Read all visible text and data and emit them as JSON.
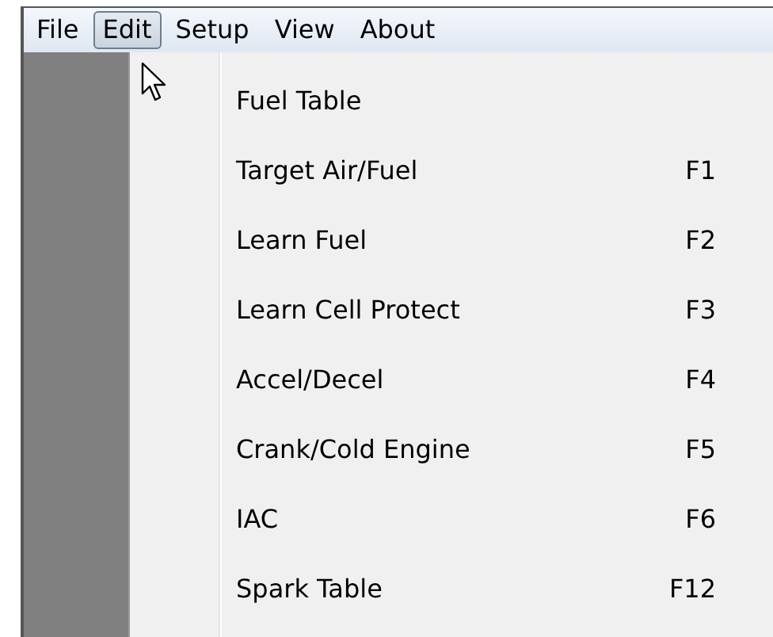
{
  "menu_bar": [
    {
      "label": "File",
      "selected": false
    },
    {
      "label": "Edit",
      "selected": true
    },
    {
      "label": "Setup",
      "selected": false
    },
    {
      "label": "View",
      "selected": false
    },
    {
      "label": "About",
      "selected": false
    }
  ],
  "edit_menu": [
    {
      "label": "Fuel Table"
    },
    {
      "label": "Target Air/Fuel",
      "shortcut": "F1"
    },
    {
      "label": "Learn Fuel",
      "shortcut": "F2"
    },
    {
      "label": "Learn Cell Protect",
      "shortcut": "F3"
    },
    {
      "label": "Accel/Decel",
      "shortcut": "F4"
    },
    {
      "label": "Crank/Cold Engine",
      "shortcut": "F5"
    },
    {
      "label": "IAC",
      "shortcut": "F6"
    },
    {
      "label": "Spark Table",
      "shortcut": "F12"
    }
  ]
}
